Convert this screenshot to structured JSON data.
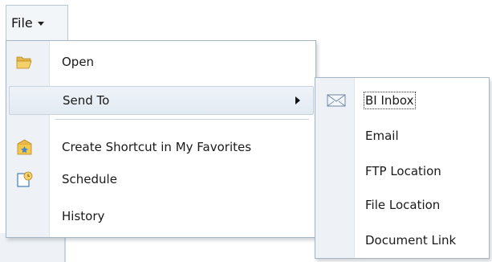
{
  "menubar": {
    "file_label": "File",
    "caret_icon": "caret-down-icon"
  },
  "file_menu": {
    "items": [
      {
        "label": "Open",
        "icon": "folder-open-icon"
      },
      {
        "label": "Send To",
        "icon": "",
        "has_submenu": true
      },
      {
        "label": "Create Shortcut in My Favorites",
        "icon": "favorites-shortcut-icon"
      },
      {
        "label": "Schedule",
        "icon": "schedule-icon"
      },
      {
        "label": "History",
        "icon": ""
      }
    ]
  },
  "send_to_submenu": {
    "items": [
      {
        "label": "BI Inbox",
        "icon": "inbox-icon",
        "focused": true
      },
      {
        "label": "Email",
        "icon": ""
      },
      {
        "label": "FTP Location",
        "icon": ""
      },
      {
        "label": "File Location",
        "icon": ""
      },
      {
        "label": "Document Link",
        "icon": ""
      }
    ]
  },
  "colors": {
    "gutter": "#eef2f6",
    "border": "#a7b6c6",
    "highlight": "#e2eaf2",
    "text": "#1a1a1a"
  }
}
